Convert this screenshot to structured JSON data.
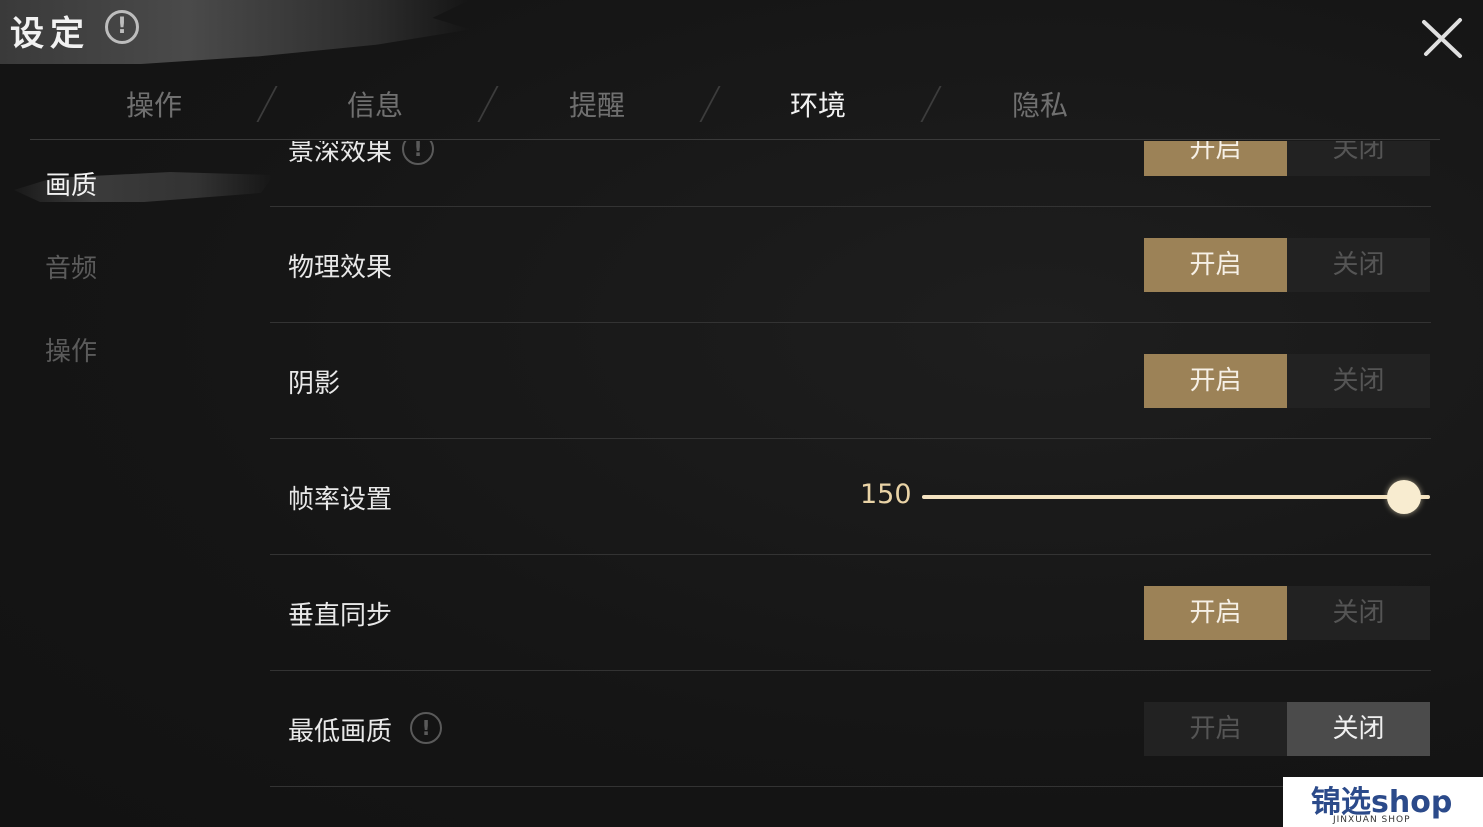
{
  "header": {
    "title": "设定",
    "help_symbol": "!"
  },
  "tabs": [
    {
      "label": "操作",
      "active": false
    },
    {
      "label": "信息",
      "active": false
    },
    {
      "label": "提醒",
      "active": false
    },
    {
      "label": "环境",
      "active": true
    },
    {
      "label": "隐私",
      "active": false
    }
  ],
  "sidebar": {
    "items": [
      {
        "label": "画质",
        "active": true
      },
      {
        "label": "音频",
        "active": false
      },
      {
        "label": "操作",
        "active": false
      }
    ]
  },
  "settings": {
    "depth_of_field": {
      "label": "景深效果",
      "on": "开启",
      "off": "关闭",
      "value": "开启"
    },
    "physics": {
      "label": "物理效果",
      "on": "开启",
      "off": "关闭",
      "value": "开启"
    },
    "shadow": {
      "label": "阴影",
      "on": "开启",
      "off": "关闭",
      "value": "开启"
    },
    "framerate": {
      "label": "帧率设置",
      "value": "150",
      "fraction": 1.0
    },
    "vsync": {
      "label": "垂直同步",
      "on": "开启",
      "off": "关闭",
      "value": "开启"
    },
    "lowest_quality": {
      "label": "最低画质",
      "on": "开启",
      "off": "关闭",
      "value": "关闭"
    }
  },
  "info_symbol": "!",
  "watermark": {
    "main": "锦选shop",
    "sub": "JINXUAN SHOP"
  },
  "colors": {
    "accent_gold": "#9c8257",
    "slider": "#f4e3c1",
    "background": "#161616"
  }
}
